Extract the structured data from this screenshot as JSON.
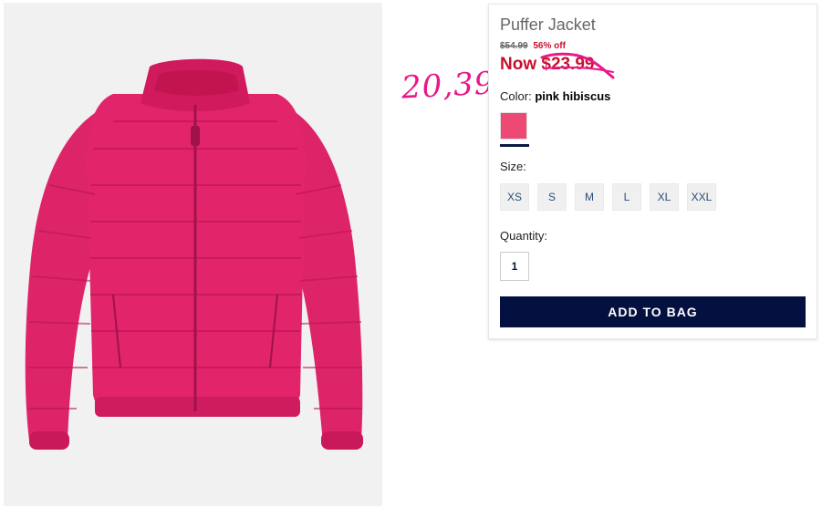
{
  "product": {
    "title": "Puffer Jacket",
    "original_price": "$54.99",
    "discount": "56% off",
    "now_price": "Now $23.99",
    "color_label": "Color:",
    "color_value": "pink hibiscus",
    "swatch_color": "#ec4a75",
    "size_label": "Size:",
    "sizes": [
      "XS",
      "S",
      "M",
      "L",
      "XL",
      "XXL"
    ],
    "quantity_label": "Quantity:",
    "quantity": "1",
    "add_to_bag": "ADD TO BAG"
  },
  "annotation": {
    "handwritten_price": "20,39",
    "color": "#e8188a"
  },
  "image": {
    "icon": "pink-puffer-jacket-image",
    "jacket_color": "#e2246a"
  }
}
